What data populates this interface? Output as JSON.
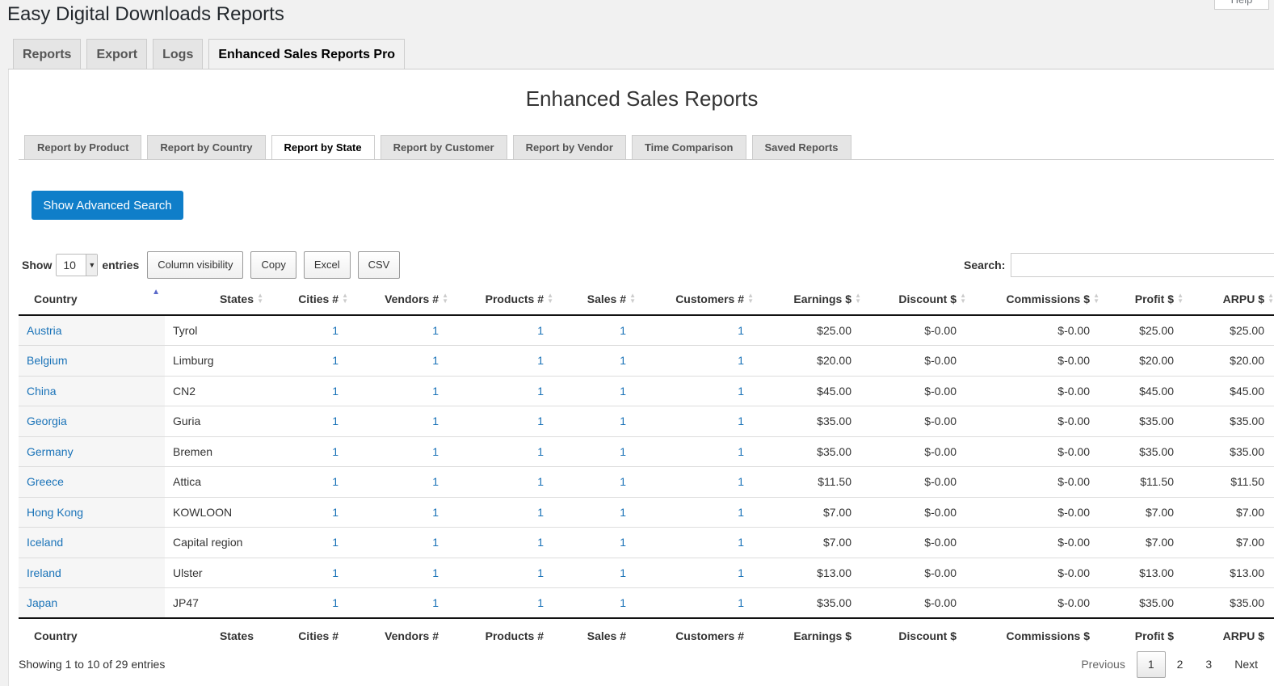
{
  "page_title": "Easy Digital Downloads Reports",
  "help_label": "Help",
  "nav_tabs": [
    {
      "label": "Reports",
      "active": false
    },
    {
      "label": "Export",
      "active": false
    },
    {
      "label": "Logs",
      "active": false
    },
    {
      "label": "Enhanced Sales Reports Pro",
      "active": true
    }
  ],
  "report_title": "Enhanced Sales Reports",
  "sub_tabs": [
    {
      "label": "Report by Product",
      "active": false
    },
    {
      "label": "Report by Country",
      "active": false
    },
    {
      "label": "Report by State",
      "active": true
    },
    {
      "label": "Report by Customer",
      "active": false
    },
    {
      "label": "Report by Vendor",
      "active": false
    },
    {
      "label": "Time Comparison",
      "active": false
    },
    {
      "label": "Saved Reports",
      "active": false
    }
  ],
  "advanced_search_label": "Show Advanced Search",
  "length": {
    "show_label": "Show",
    "value": "10",
    "entries_label": "entries"
  },
  "buttons": {
    "column_visibility": "Column visibility",
    "copy": "Copy",
    "excel": "Excel",
    "csv": "CSV"
  },
  "search": {
    "label": "Search:",
    "placeholder": ""
  },
  "columns": [
    "Country",
    "States",
    "Cities #",
    "Vendors #",
    "Products #",
    "Sales #",
    "Customers #",
    "Earnings $",
    "Discount $",
    "Commissions $",
    "Profit $",
    "ARPU $"
  ],
  "rows": [
    [
      "Austria",
      "Tyrol",
      "1",
      "1",
      "1",
      "1",
      "1",
      "$25.00",
      "$-0.00",
      "$-0.00",
      "$25.00",
      "$25.00"
    ],
    [
      "Belgium",
      "Limburg",
      "1",
      "1",
      "1",
      "1",
      "1",
      "$20.00",
      "$-0.00",
      "$-0.00",
      "$20.00",
      "$20.00"
    ],
    [
      "China",
      "CN2",
      "1",
      "1",
      "1",
      "1",
      "1",
      "$45.00",
      "$-0.00",
      "$-0.00",
      "$45.00",
      "$45.00"
    ],
    [
      "Georgia",
      "Guria",
      "1",
      "1",
      "1",
      "1",
      "1",
      "$35.00",
      "$-0.00",
      "$-0.00",
      "$35.00",
      "$35.00"
    ],
    [
      "Germany",
      "Bremen",
      "1",
      "1",
      "1",
      "1",
      "1",
      "$35.00",
      "$-0.00",
      "$-0.00",
      "$35.00",
      "$35.00"
    ],
    [
      "Greece",
      "Attica",
      "1",
      "1",
      "1",
      "1",
      "1",
      "$11.50",
      "$-0.00",
      "$-0.00",
      "$11.50",
      "$11.50"
    ],
    [
      "Hong Kong",
      "KOWLOON",
      "1",
      "1",
      "1",
      "1",
      "1",
      "$7.00",
      "$-0.00",
      "$-0.00",
      "$7.00",
      "$7.00"
    ],
    [
      "Iceland",
      "Capital region",
      "1",
      "1",
      "1",
      "1",
      "1",
      "$7.00",
      "$-0.00",
      "$-0.00",
      "$7.00",
      "$7.00"
    ],
    [
      "Ireland",
      "Ulster",
      "1",
      "1",
      "1",
      "1",
      "1",
      "$13.00",
      "$-0.00",
      "$-0.00",
      "$13.00",
      "$13.00"
    ],
    [
      "Japan",
      "JP47",
      "1",
      "1",
      "1",
      "1",
      "1",
      "$35.00",
      "$-0.00",
      "$-0.00",
      "$35.00",
      "$35.00"
    ]
  ],
  "info_text": "Showing 1 to 10 of 29 entries",
  "pagination": {
    "previous": "Previous",
    "pages": [
      "1",
      "2",
      "3"
    ],
    "current": "1",
    "next": "Next"
  },
  "colors": {
    "accent": "#0f7ec9",
    "link": "#1a73b8"
  }
}
